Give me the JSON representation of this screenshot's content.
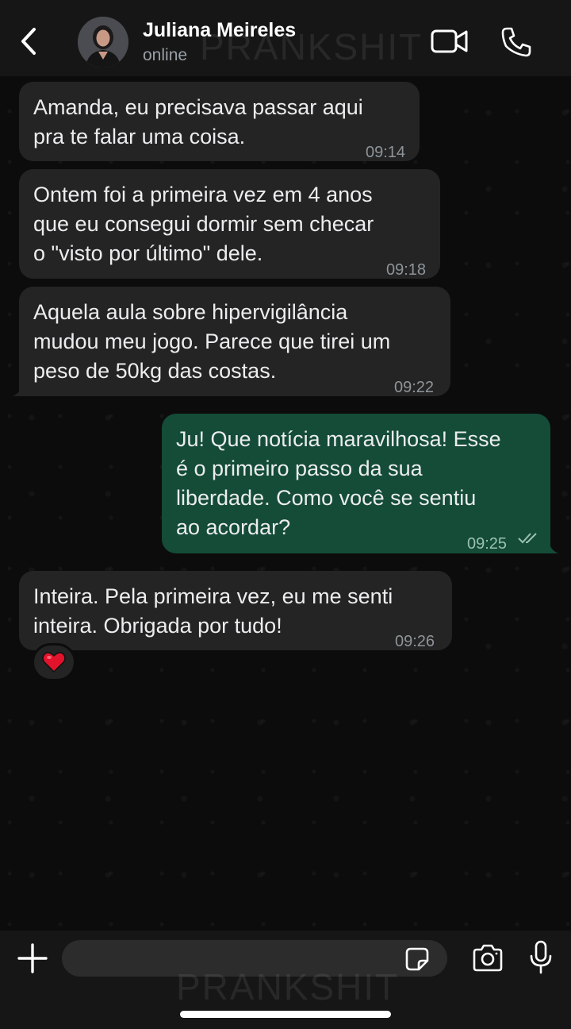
{
  "header": {
    "contact_name": "Juliana Meireles",
    "status": "online",
    "watermark": "PRANKSHIT"
  },
  "messages": [
    {
      "direction": "incoming",
      "lines": [
        "Amanda, eu precisava passar aqui",
        "pra te falar uma coisa."
      ],
      "time": "09:14"
    },
    {
      "direction": "incoming",
      "lines": [
        "Ontem foi a primeira vez em 4 anos",
        "que eu consegui dormir sem checar",
        "o \"visto por último\" dele."
      ],
      "time": "09:18"
    },
    {
      "direction": "incoming",
      "lines": [
        "Aquela aula sobre hipervigilância",
        "mudou meu jogo. Parece que tirei um",
        "peso de 50kg das costas."
      ],
      "time": "09:22"
    },
    {
      "direction": "outgoing",
      "lines": [
        "Ju! Que notícia maravilhosa! Esse",
        "é o primeiro passo da sua",
        "liberdade. Como você se sentiu",
        "ao acordar?"
      ],
      "time": "09:25",
      "status": "read"
    },
    {
      "direction": "incoming",
      "lines": [
        "Inteira. Pela primeira vez, eu me senti",
        "inteira. Obrigada por tudo!"
      ],
      "time": "09:26",
      "reaction": "heart"
    }
  ],
  "composer": {
    "placeholder": "",
    "value": ""
  },
  "icons": {
    "back": "chevron-left-icon",
    "video": "video-call-icon",
    "phone": "phone-icon",
    "plus": "plus-icon",
    "sticker": "sticker-icon",
    "camera": "camera-icon",
    "mic": "microphone-icon",
    "reaction": "heart-icon"
  },
  "colors": {
    "incoming_bubble": "#242424",
    "outgoing_bubble": "#144c37",
    "reaction_heart": "#e3132c"
  }
}
